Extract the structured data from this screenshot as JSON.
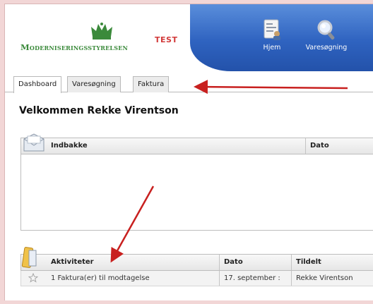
{
  "header": {
    "logo_text": "Moderniseringsstyrelsen",
    "test_badge": "TEST",
    "nav": [
      {
        "label": "Hjem",
        "icon": "document-person-icon"
      },
      {
        "label": "Varesøgning",
        "icon": "magnifier-icon"
      }
    ]
  },
  "tabs": [
    {
      "label": "Dashboard",
      "active": true
    },
    {
      "label": "Varesøgning",
      "active": false
    },
    {
      "label": "Faktura",
      "active": false
    }
  ],
  "welcome": "Velkommen Rekke Virentson",
  "inbox": {
    "columns": [
      "Indbakke",
      "Dato"
    ],
    "rows": []
  },
  "activities": {
    "columns": [
      "Aktiviteter",
      "Dato",
      "Tildelt"
    ],
    "rows": [
      {
        "activity": "1 Faktura(er) til modtagelse",
        "date": "17. september :",
        "assigned": "Rekke Virentson"
      }
    ]
  },
  "colors": {
    "nav_blue": "#2f63c0",
    "logo_green": "#3b8a3b",
    "test_red": "#d23a3a",
    "annotation_red": "#c8201f"
  }
}
